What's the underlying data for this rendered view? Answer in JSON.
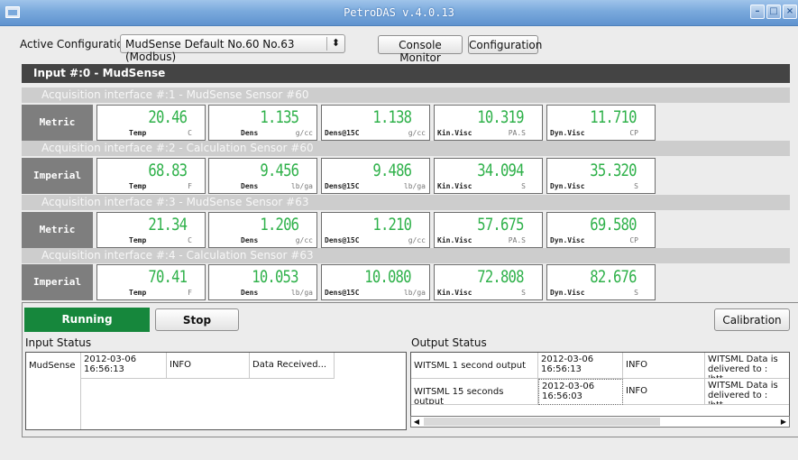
{
  "window": {
    "title": "PetroDAS v.4.0.13"
  },
  "config": {
    "label": "Active Configuration",
    "selected": "MudSense Default No.60 No.63 (Modbus)",
    "console_button": "Console Monitor",
    "configuration_button": "Configuration"
  },
  "input_header": "Input #:0 - MudSense",
  "interfaces": [
    {
      "title": "Acquisition interface #:1 - MudSense Sensor #60",
      "unit_system": "Metric",
      "readings": [
        {
          "value": "20.46",
          "name": "Temp",
          "unit": "C"
        },
        {
          "value": "1.135",
          "name": "Dens",
          "unit": "g/cc"
        },
        {
          "value": "1.138",
          "name": "Dens@15C",
          "unit": "g/cc"
        },
        {
          "value": "10.319",
          "name": "Kin.Visc",
          "unit": "PA.S"
        },
        {
          "value": "11.710",
          "name": "Dyn.Visc",
          "unit": "CP"
        }
      ]
    },
    {
      "title": "Acquisition interface #:2 - Calculation Sensor #60",
      "unit_system": "Imperial",
      "readings": [
        {
          "value": "68.83",
          "name": "Temp",
          "unit": "F"
        },
        {
          "value": "9.456",
          "name": "Dens",
          "unit": "lb/ga"
        },
        {
          "value": "9.486",
          "name": "Dens@15C",
          "unit": "lb/ga"
        },
        {
          "value": "34.094",
          "name": "Kin.Visc",
          "unit": "S"
        },
        {
          "value": "35.320",
          "name": "Dyn.Visc",
          "unit": "S"
        }
      ]
    },
    {
      "title": "Acquisition interface #:3 - MudSense Sensor #63",
      "unit_system": "Metric",
      "readings": [
        {
          "value": "21.34",
          "name": "Temp",
          "unit": "C"
        },
        {
          "value": "1.206",
          "name": "Dens",
          "unit": "g/cc"
        },
        {
          "value": "1.210",
          "name": "Dens@15C",
          "unit": "g/cc"
        },
        {
          "value": "57.675",
          "name": "Kin.Visc",
          "unit": "PA.S"
        },
        {
          "value": "69.580",
          "name": "Dyn.Visc",
          "unit": "CP"
        }
      ]
    },
    {
      "title": "Acquisition interface #:4 - Calculation Sensor #63",
      "unit_system": "Imperial",
      "readings": [
        {
          "value": "70.41",
          "name": "Temp",
          "unit": "F"
        },
        {
          "value": "10.053",
          "name": "Dens",
          "unit": "lb/ga"
        },
        {
          "value": "10.080",
          "name": "Dens@15C",
          "unit": "lb/ga"
        },
        {
          "value": "72.808",
          "name": "Kin.Visc",
          "unit": "S"
        },
        {
          "value": "82.676",
          "name": "Dyn.Visc",
          "unit": "S"
        }
      ]
    }
  ],
  "controls": {
    "running": "Running",
    "stop": "Stop",
    "calibration": "Calibration"
  },
  "input_status": {
    "label": "Input Status",
    "rows": [
      {
        "source": "MudSense",
        "time": "2012-03-06 16:56:13",
        "level": "INFO",
        "message": "Data Received..."
      }
    ]
  },
  "output_status": {
    "label": "Output Status",
    "rows": [
      {
        "source": "WITSML 1 second output",
        "time": "2012-03-06 16:56:13",
        "level": "INFO",
        "message": "WITSML Data is delivered to : 'htt..."
      },
      {
        "source": "WITSML 15 seconds output",
        "time": "2012-03-06 16:56:03",
        "level": "INFO",
        "message": "WITSML Data is delivered to : 'htt..."
      }
    ]
  },
  "colors": {
    "running": "#16873c",
    "lcd_green": "#2fb14a",
    "header": "#444444",
    "titlebar": "#7aa9dc"
  },
  "icons": [
    "app-icon",
    "minimize-icon",
    "maximize-icon",
    "close-icon",
    "dropdown-arrows-icon",
    "scroll-left-icon",
    "scroll-right-icon"
  ]
}
